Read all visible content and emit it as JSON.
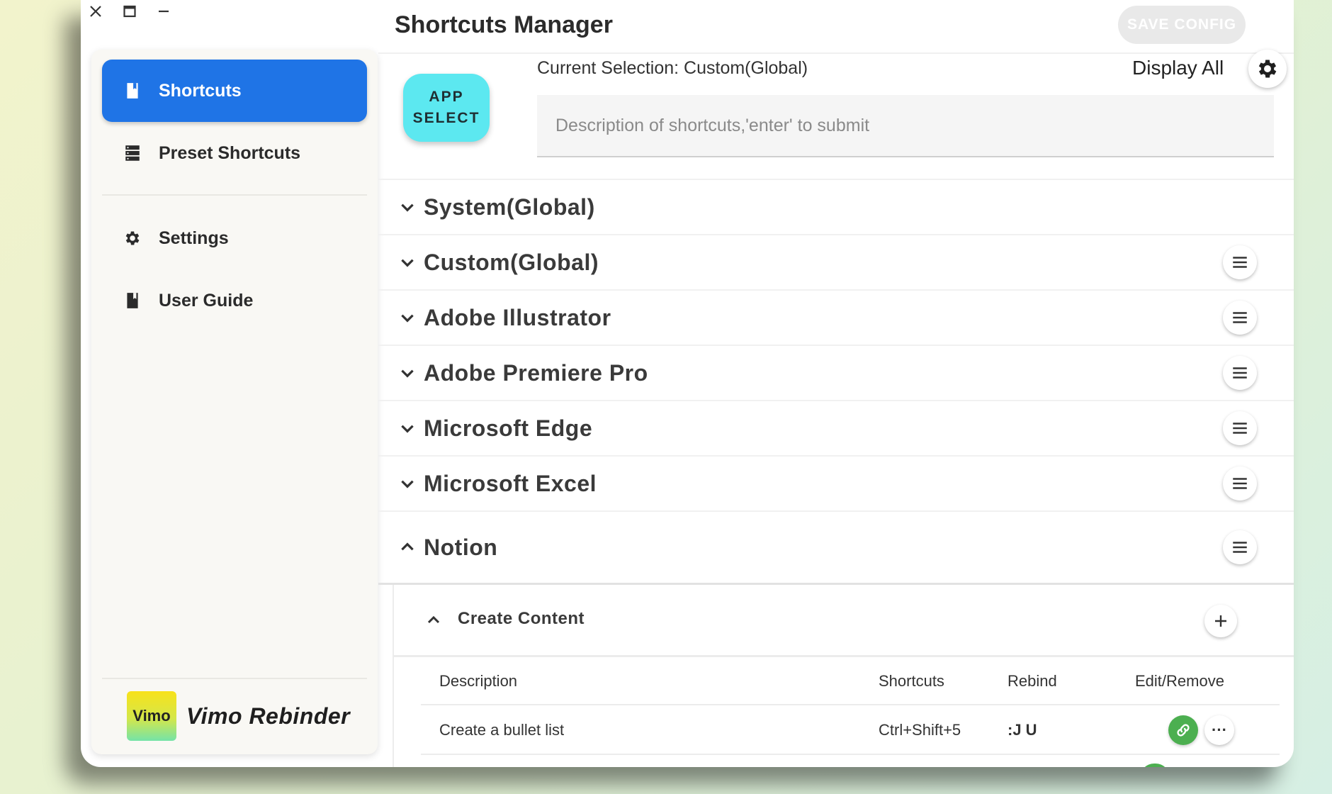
{
  "window": {
    "controls": [
      "close",
      "maximize",
      "minimize"
    ]
  },
  "sidebar": {
    "items": [
      {
        "label": "Shortcuts",
        "icon": "bookmark-icon",
        "active": true
      },
      {
        "label": "Preset Shortcuts",
        "icon": "server-icon",
        "active": false
      },
      {
        "label": "Settings",
        "icon": "gear-icon",
        "active": false
      },
      {
        "label": "User Guide",
        "icon": "book-icon",
        "active": false
      }
    ],
    "brand": {
      "logo_text": "Vimo",
      "name": "Vimo Rebinder"
    }
  },
  "header": {
    "title": "Shortcuts Manager",
    "save_label": "SAVE CONFIG"
  },
  "toolbar": {
    "app_select_label": "APP\nSELECT",
    "current_selection": "Current Selection: Custom(Global)",
    "display_all": "Display All",
    "description_placeholder": "Description of shortcuts,'enter' to submit"
  },
  "groups": [
    {
      "title": "System(Global)",
      "expanded": false,
      "has_menu": false
    },
    {
      "title": "Custom(Global)",
      "expanded": false,
      "has_menu": true
    },
    {
      "title": "Adobe Illustrator",
      "expanded": false,
      "has_menu": true
    },
    {
      "title": "Adobe Premiere Pro",
      "expanded": false,
      "has_menu": true
    },
    {
      "title": "Microsoft Edge",
      "expanded": false,
      "has_menu": true
    },
    {
      "title": "Microsoft Excel",
      "expanded": false,
      "has_menu": true
    },
    {
      "title": "Notion",
      "expanded": true,
      "has_menu": true
    }
  ],
  "notion": {
    "subgroup_title": "Create Content",
    "columns": [
      "Description",
      "Shortcuts",
      "Rebind",
      "Edit/Remove"
    ],
    "rows": [
      {
        "description": "Create a bullet list",
        "shortcut": "Ctrl+Shift+5",
        "rebind": ":J U"
      }
    ]
  },
  "colors": {
    "accent": "#1f74e6",
    "app_select": "#5ce8f0",
    "link_button": "#4caf50",
    "save_disabled": "#e9e9e9"
  }
}
